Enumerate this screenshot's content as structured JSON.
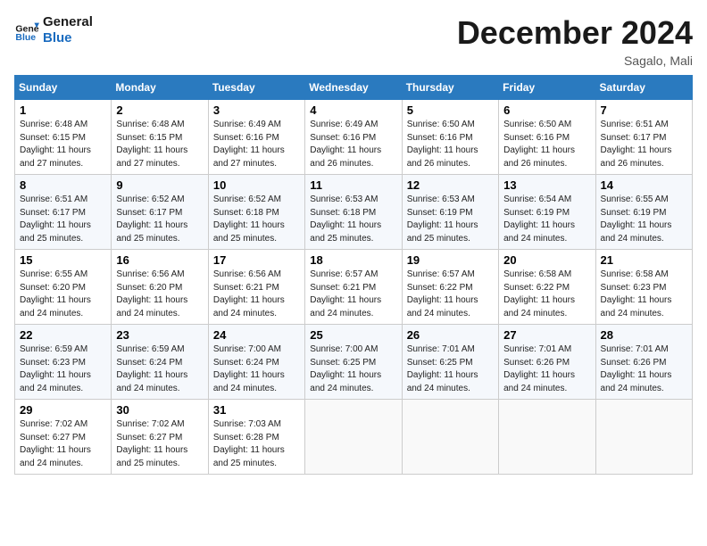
{
  "header": {
    "logo_line1": "General",
    "logo_line2": "Blue",
    "month": "December 2024",
    "location": "Sagalo, Mali"
  },
  "days_of_week": [
    "Sunday",
    "Monday",
    "Tuesday",
    "Wednesday",
    "Thursday",
    "Friday",
    "Saturday"
  ],
  "weeks": [
    [
      {
        "day": "1",
        "info": "Sunrise: 6:48 AM\nSunset: 6:15 PM\nDaylight: 11 hours and 27 minutes."
      },
      {
        "day": "2",
        "info": "Sunrise: 6:48 AM\nSunset: 6:15 PM\nDaylight: 11 hours and 27 minutes."
      },
      {
        "day": "3",
        "info": "Sunrise: 6:49 AM\nSunset: 6:16 PM\nDaylight: 11 hours and 27 minutes."
      },
      {
        "day": "4",
        "info": "Sunrise: 6:49 AM\nSunset: 6:16 PM\nDaylight: 11 hours and 26 minutes."
      },
      {
        "day": "5",
        "info": "Sunrise: 6:50 AM\nSunset: 6:16 PM\nDaylight: 11 hours and 26 minutes."
      },
      {
        "day": "6",
        "info": "Sunrise: 6:50 AM\nSunset: 6:16 PM\nDaylight: 11 hours and 26 minutes."
      },
      {
        "day": "7",
        "info": "Sunrise: 6:51 AM\nSunset: 6:17 PM\nDaylight: 11 hours and 26 minutes."
      }
    ],
    [
      {
        "day": "8",
        "info": "Sunrise: 6:51 AM\nSunset: 6:17 PM\nDaylight: 11 hours and 25 minutes."
      },
      {
        "day": "9",
        "info": "Sunrise: 6:52 AM\nSunset: 6:17 PM\nDaylight: 11 hours and 25 minutes."
      },
      {
        "day": "10",
        "info": "Sunrise: 6:52 AM\nSunset: 6:18 PM\nDaylight: 11 hours and 25 minutes."
      },
      {
        "day": "11",
        "info": "Sunrise: 6:53 AM\nSunset: 6:18 PM\nDaylight: 11 hours and 25 minutes."
      },
      {
        "day": "12",
        "info": "Sunrise: 6:53 AM\nSunset: 6:19 PM\nDaylight: 11 hours and 25 minutes."
      },
      {
        "day": "13",
        "info": "Sunrise: 6:54 AM\nSunset: 6:19 PM\nDaylight: 11 hours and 24 minutes."
      },
      {
        "day": "14",
        "info": "Sunrise: 6:55 AM\nSunset: 6:19 PM\nDaylight: 11 hours and 24 minutes."
      }
    ],
    [
      {
        "day": "15",
        "info": "Sunrise: 6:55 AM\nSunset: 6:20 PM\nDaylight: 11 hours and 24 minutes."
      },
      {
        "day": "16",
        "info": "Sunrise: 6:56 AM\nSunset: 6:20 PM\nDaylight: 11 hours and 24 minutes."
      },
      {
        "day": "17",
        "info": "Sunrise: 6:56 AM\nSunset: 6:21 PM\nDaylight: 11 hours and 24 minutes."
      },
      {
        "day": "18",
        "info": "Sunrise: 6:57 AM\nSunset: 6:21 PM\nDaylight: 11 hours and 24 minutes."
      },
      {
        "day": "19",
        "info": "Sunrise: 6:57 AM\nSunset: 6:22 PM\nDaylight: 11 hours and 24 minutes."
      },
      {
        "day": "20",
        "info": "Sunrise: 6:58 AM\nSunset: 6:22 PM\nDaylight: 11 hours and 24 minutes."
      },
      {
        "day": "21",
        "info": "Sunrise: 6:58 AM\nSunset: 6:23 PM\nDaylight: 11 hours and 24 minutes."
      }
    ],
    [
      {
        "day": "22",
        "info": "Sunrise: 6:59 AM\nSunset: 6:23 PM\nDaylight: 11 hours and 24 minutes."
      },
      {
        "day": "23",
        "info": "Sunrise: 6:59 AM\nSunset: 6:24 PM\nDaylight: 11 hours and 24 minutes."
      },
      {
        "day": "24",
        "info": "Sunrise: 7:00 AM\nSunset: 6:24 PM\nDaylight: 11 hours and 24 minutes."
      },
      {
        "day": "25",
        "info": "Sunrise: 7:00 AM\nSunset: 6:25 PM\nDaylight: 11 hours and 24 minutes."
      },
      {
        "day": "26",
        "info": "Sunrise: 7:01 AM\nSunset: 6:25 PM\nDaylight: 11 hours and 24 minutes."
      },
      {
        "day": "27",
        "info": "Sunrise: 7:01 AM\nSunset: 6:26 PM\nDaylight: 11 hours and 24 minutes."
      },
      {
        "day": "28",
        "info": "Sunrise: 7:01 AM\nSunset: 6:26 PM\nDaylight: 11 hours and 24 minutes."
      }
    ],
    [
      {
        "day": "29",
        "info": "Sunrise: 7:02 AM\nSunset: 6:27 PM\nDaylight: 11 hours and 24 minutes."
      },
      {
        "day": "30",
        "info": "Sunrise: 7:02 AM\nSunset: 6:27 PM\nDaylight: 11 hours and 25 minutes."
      },
      {
        "day": "31",
        "info": "Sunrise: 7:03 AM\nSunset: 6:28 PM\nDaylight: 11 hours and 25 minutes."
      },
      null,
      null,
      null,
      null
    ]
  ]
}
